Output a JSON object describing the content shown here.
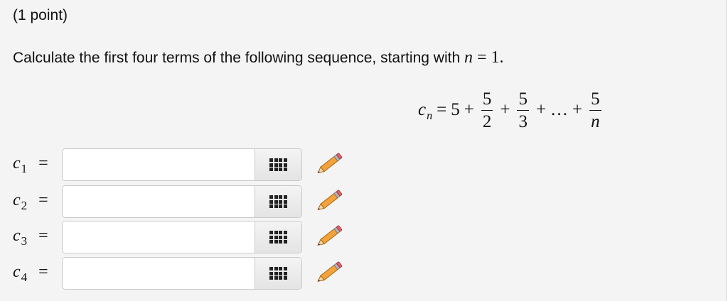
{
  "problem": {
    "points_label": "(1 point)",
    "question_text": "Calculate the first four terms of the following sequence, starting with",
    "question_var": "n",
    "question_eq": "=",
    "question_value": "1",
    "question_end": "."
  },
  "formula": {
    "lhs_var": "c",
    "lhs_sub": "n",
    "eq": "=",
    "first_term": "5",
    "plus": "+",
    "ellipsis": "…",
    "fractions": [
      {
        "num": "5",
        "den": "2"
      },
      {
        "num": "5",
        "den": "3"
      },
      {
        "num": "5",
        "den": "n"
      }
    ]
  },
  "answers": [
    {
      "var": "c",
      "sub": "1",
      "eq": "=",
      "value": "",
      "placeholder": ""
    },
    {
      "var": "c",
      "sub": "2",
      "eq": "=",
      "value": "",
      "placeholder": ""
    },
    {
      "var": "c",
      "sub": "3",
      "eq": "=",
      "value": "",
      "placeholder": ""
    },
    {
      "var": "c",
      "sub": "4",
      "eq": "=",
      "value": "",
      "placeholder": ""
    }
  ],
  "icons": {
    "equation_editor": "grid-icon",
    "edit": "pencil-icon"
  },
  "colors": {
    "panel_background": "#f4f4f4",
    "pencil_body": "#f2a33a",
    "pencil_eraser": "#e8626b"
  }
}
